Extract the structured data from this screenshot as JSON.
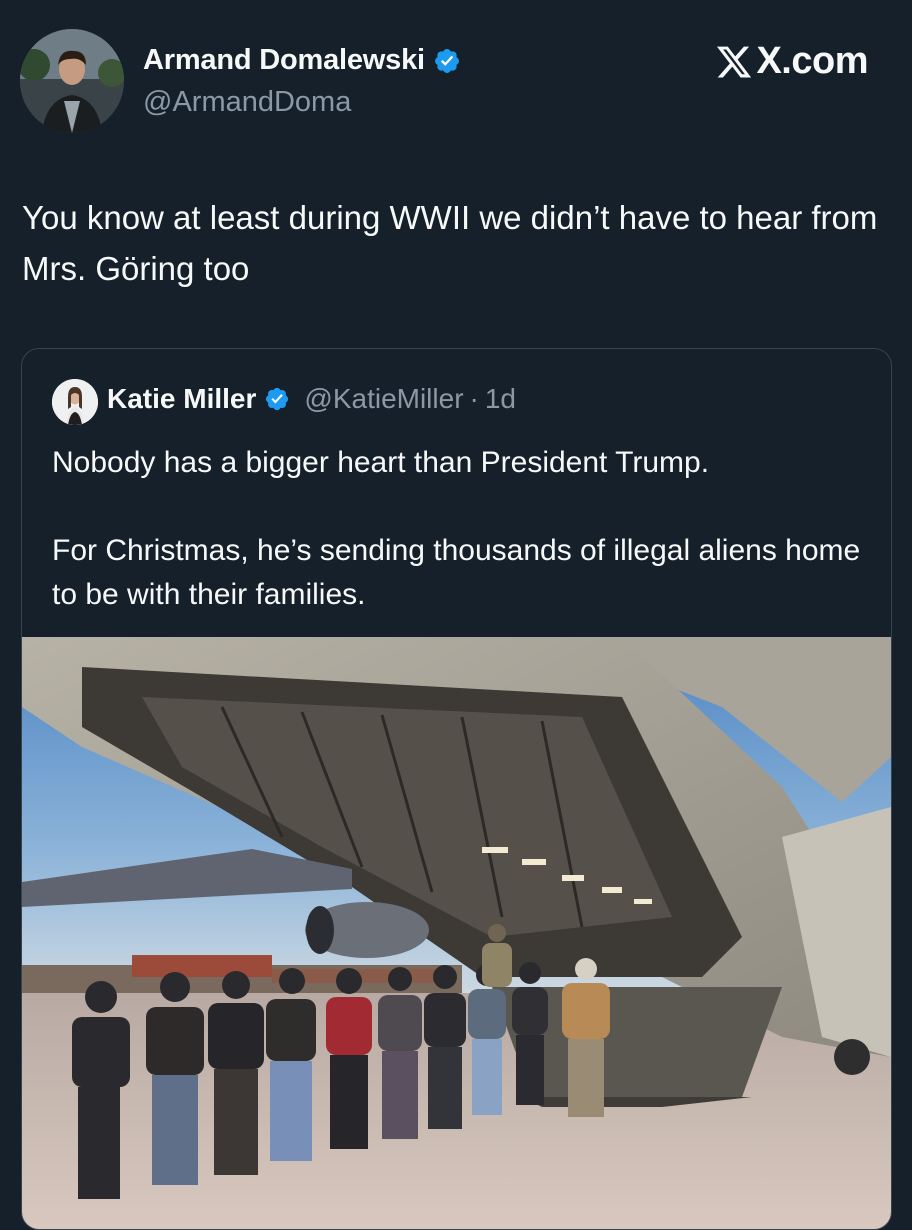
{
  "post": {
    "author": {
      "name": "Armand Domalewski",
      "handle": "@ArmandDoma",
      "verified": true
    },
    "brand": "X.com",
    "text": "You know at least during WWII we didn’t have to hear from Mrs. Göring too"
  },
  "quoted_post": {
    "author": {
      "name": "Katie Miller",
      "handle": "@KatieMiller",
      "verified": true
    },
    "separator": "·",
    "time": "1d",
    "text": "Nobody has a bigger heart than President Trump.\n\nFor Christmas, he’s sending thousands of illegal aliens home to be with their families.",
    "media": {
      "icon": "photo-image",
      "subject": "people walking up the rear ramp of a military cargo plane on an airfield"
    }
  },
  "colors": {
    "background": "#15202b",
    "text_primary": "#f7f9f9",
    "text_secondary": "#8b98a5",
    "border": "#38444d",
    "verified_blue": "#1d9bf0"
  }
}
